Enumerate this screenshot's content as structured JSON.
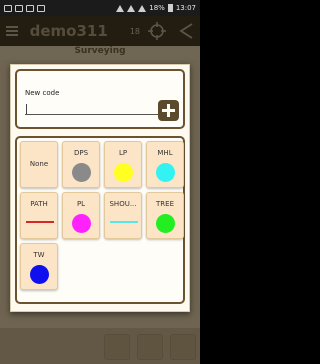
{
  "statusbar": {
    "battery": "18%",
    "time": "13:07"
  },
  "app": {
    "title": "demo311",
    "badge": "18",
    "subheader": "Surveying"
  },
  "dialog": {
    "code_label": "New code",
    "code_value": "",
    "add_icon": "plus-icon",
    "codes": [
      {
        "label": "None",
        "style": "none",
        "color": ""
      },
      {
        "label": "DPS",
        "style": "point",
        "color": "#8a8a8a"
      },
      {
        "label": "LP",
        "style": "point",
        "color": "#ffff22"
      },
      {
        "label": "MHL",
        "style": "point",
        "color": "#33f2f2"
      },
      {
        "label": "PATH",
        "style": "line",
        "color": "#d62828"
      },
      {
        "label": "PL",
        "style": "point",
        "color": "#ff22ff"
      },
      {
        "label": "SHOU...",
        "style": "line",
        "color": "#55e8e8"
      },
      {
        "label": "TREE",
        "style": "point",
        "color": "#22ee22"
      },
      {
        "label": "TW",
        "style": "point",
        "color": "#1010ee"
      }
    ]
  }
}
